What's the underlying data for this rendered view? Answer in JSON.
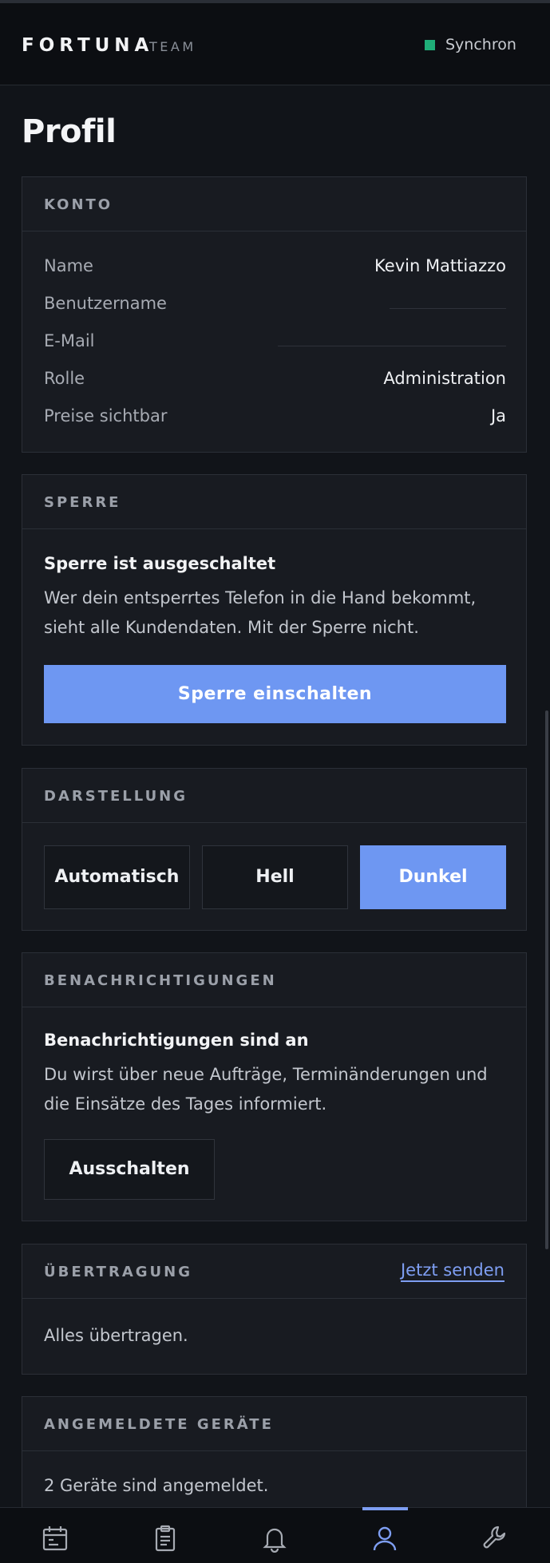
{
  "header": {
    "brand": "FORTUNA",
    "brand_sub": "TEAM",
    "sync_status": "Synchron",
    "sync_color": "#1fae78"
  },
  "page": {
    "title": "Profil"
  },
  "konto": {
    "title": "KONTO",
    "rows": [
      {
        "label": "Name",
        "value": "Kevin Mattiazzo"
      },
      {
        "label": "Benutzername",
        "value": ""
      },
      {
        "label": "E-Mail",
        "value": ""
      },
      {
        "label": "Rolle",
        "value": "Administration"
      },
      {
        "label": "Preise sichtbar",
        "value": "Ja"
      }
    ]
  },
  "sperre": {
    "title": "SPERRE",
    "status": "Sperre ist ausgeschaltet",
    "description": "Wer dein entsperrtes Telefon in die Hand bekommt, sieht alle Kundendaten. Mit der Sperre nicht.",
    "button_label": "Sperre einschalten"
  },
  "darstellung": {
    "title": "DARSTELLUNG",
    "options": [
      "Automatisch",
      "Hell",
      "Dunkel"
    ],
    "selected": "Dunkel"
  },
  "benachrichtigungen": {
    "title": "BENACHRICHTIGUNGEN",
    "status": "Benachrichtigungen sind an",
    "description": "Du wirst über neue Aufträge, Terminänderungen und die Einsätze des Tages informiert.",
    "button_label": "Ausschalten"
  },
  "uebertragung": {
    "title": "ÜBERTRAGUNG",
    "action_label": "Jetzt senden",
    "status": "Alles übertragen."
  },
  "geraete": {
    "title": "ANGEMELDETE GERÄTE",
    "status": "2 Geräte sind angemeldet."
  },
  "bottom_nav": {
    "items": [
      {
        "icon": "calendar-icon"
      },
      {
        "icon": "clipboard-icon"
      },
      {
        "icon": "bell-icon"
      },
      {
        "icon": "user-icon",
        "active": true
      },
      {
        "icon": "wrench-icon"
      }
    ],
    "accent": "#7e9ef2"
  },
  "colors": {
    "background": "#111419",
    "card": "#181b21",
    "accent": "#6e97f2"
  }
}
